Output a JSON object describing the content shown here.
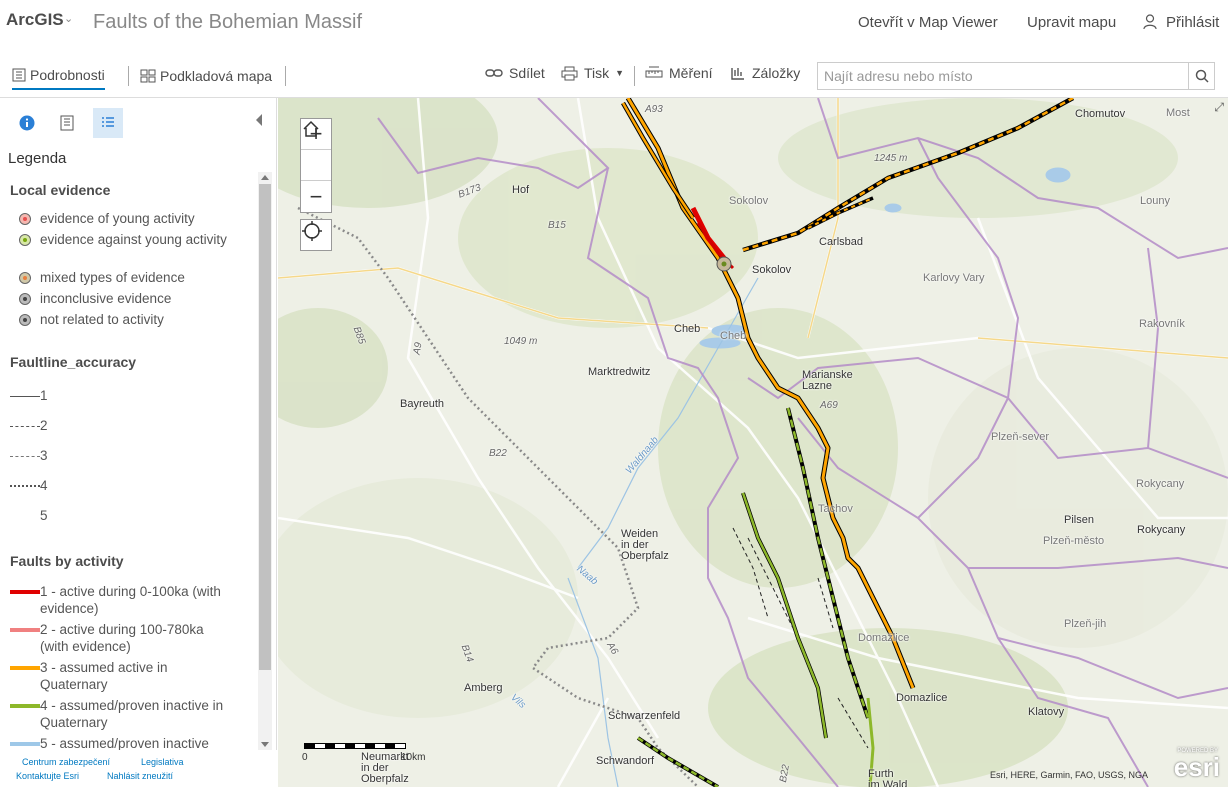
{
  "header": {
    "logo": "ArcGIS",
    "title": "Faults of the Bohemian Massif",
    "open_map_viewer": "Otevřít v Map Viewer",
    "edit_map": "Upravit mapu",
    "sign_in": "Přihlásit"
  },
  "toolbar": {
    "tab_details": "Podrobnosti",
    "tab_basemap": "Podkladová mapa",
    "share": "Sdílet",
    "print": "Tisk",
    "measure": "Měření",
    "bookmarks": "Záložky",
    "search_placeholder": "Najít adresu nebo místo"
  },
  "panel": {
    "legend_title": "Legenda",
    "sections": {
      "local_evidence": {
        "title": "Local evidence",
        "items": [
          {
            "label": "evidence of young activity",
            "color": "#e85050"
          },
          {
            "label": "evidence against young activity",
            "color": "#8ab820"
          },
          {
            "label": "mixed types of evidence",
            "color": "#e88040"
          },
          {
            "label": "inconclusive evidence",
            "color": "#444444"
          },
          {
            "label": "not related to activity",
            "color": "#444444"
          }
        ]
      },
      "accuracy": {
        "title": "Faultline_accuracy",
        "items": [
          "1",
          "2",
          "3",
          "4",
          "5"
        ]
      },
      "activity": {
        "title": "Faults by activity",
        "items": [
          {
            "label": "1 - active during 0-100ka (with evidence)",
            "color": "#e00000"
          },
          {
            "label": "2 - active during 100-780ka (with evidence)",
            "color": "#f08080"
          },
          {
            "label": "3 - assumed active in Quaternary",
            "color": "#ffa500"
          },
          {
            "label": "4 - assumed/proven inactive in Quaternary",
            "color": "#8db82a"
          },
          {
            "label": "5 - assumed/proven inactive",
            "color": "#9ec8e8"
          }
        ]
      }
    },
    "footer": {
      "privacy": "Centrum zabezpečení",
      "legal": "Legislativa",
      "contact": "Kontaktujte Esri",
      "report": "Nahlásit zneužití"
    }
  },
  "map": {
    "labels": {
      "hof": "Hof",
      "chomutov": "Chomutov",
      "most": "Most",
      "sokolov_top": "Sokolov",
      "carlsbad": "Carlsbad",
      "sokolov": "Sokolov",
      "karlovy_vary": "Karlovy Vary",
      "louny": "Louny",
      "rakovnik": "Rakovník",
      "cheb_de": "Cheb",
      "cheb": "Cheb",
      "marktredwitz": "Marktredwitz",
      "marianske": "Marianske\nLazne",
      "bayreuth": "Bayreuth",
      "plzen_sever": "Plzeň-sever",
      "rokycany_region": "Rokycany",
      "pilsen": "Pilsen",
      "plzen_mesto": "Plzeň-město",
      "rokycany": "Rokycany",
      "tachov": "Tachov",
      "weiden": "Weiden\nin der\nOberpfalz",
      "plzen_jih": "Plzeň-jih",
      "domazlice_region": "Domažlice",
      "amberg": "Amberg",
      "domazlice": "Domazlice",
      "schwarzenfeld": "Schwarzenfeld",
      "klatovy": "Klatovy",
      "schwandorf": "Schwandorf",
      "neumarkt": "Neumarkt\nin der\nOberpfalz",
      "furth": "Furth\nim Wald",
      "elev1": "1245 m",
      "elev2": "1049 m",
      "b173": "B173",
      "b15": "B15",
      "a93": "A93",
      "a9": "A9",
      "b22": "B22",
      "b85": "B85",
      "b14": "B14",
      "a6": "A6",
      "b22b": "B22",
      "a69": "A69",
      "waldnaab": "Waldnaab",
      "naab": "Naab",
      "vils": "Vils"
    },
    "scale_zero": "0",
    "scale_label": "10km",
    "attribution": "Esri, HERE, Garmin, FAO, USGS, NGA",
    "esri": "esri",
    "powered_by": "POWERED BY"
  }
}
